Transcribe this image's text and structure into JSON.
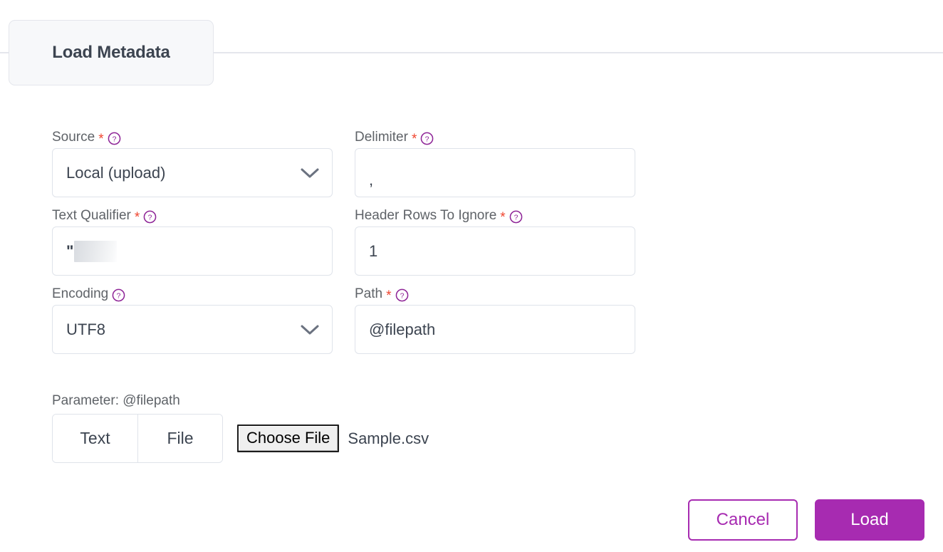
{
  "tab": {
    "label": "Load Metadata"
  },
  "colors": {
    "accent": "#a72bb1",
    "required_star": "#f0452f",
    "label_text": "#5f6368",
    "value_text": "#3c4450",
    "border": "#dfe3ea",
    "tab_bg": "#f7f8fa"
  },
  "form": {
    "required_marker": "*",
    "help_icon_name": "help-circle-icon",
    "fields": [
      {
        "key": "source",
        "label": "Source",
        "required": true,
        "has_help": true,
        "type": "select",
        "value": "Local (upload)"
      },
      {
        "key": "delimiter",
        "label": "Delimiter",
        "required": true,
        "has_help": true,
        "type": "text",
        "value": ","
      },
      {
        "key": "text_qualifier",
        "label": "Text Qualifier",
        "required": true,
        "has_help": true,
        "type": "text",
        "value": "\""
      },
      {
        "key": "header_rows_to_ignore",
        "label": "Header Rows To Ignore",
        "required": true,
        "has_help": true,
        "type": "text",
        "value": "1"
      },
      {
        "key": "encoding",
        "label": "Encoding",
        "required": false,
        "has_help": true,
        "type": "select",
        "value": "UTF8"
      },
      {
        "key": "path",
        "label": "Path",
        "required": true,
        "has_help": true,
        "type": "text",
        "value": "@filepath"
      }
    ]
  },
  "parameter": {
    "label": "Parameter: @filepath",
    "modes": [
      {
        "key": "text",
        "label": "Text",
        "selected": false
      },
      {
        "key": "file",
        "label": "File",
        "selected": false
      }
    ],
    "file_picker": {
      "button_label": "Choose File",
      "file_name": "Sample.csv"
    }
  },
  "actions": {
    "cancel_label": "Cancel",
    "load_label": "Load"
  }
}
